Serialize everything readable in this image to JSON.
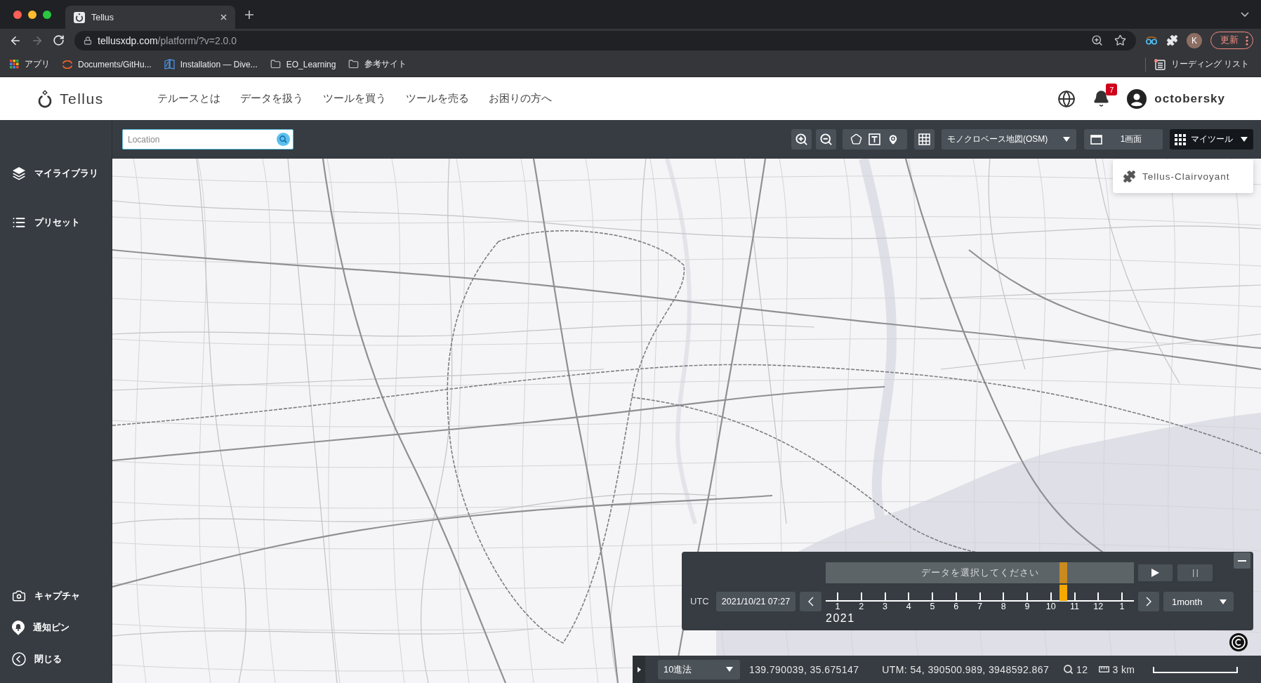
{
  "browser": {
    "tabs": [
      {
        "title": "Tellus",
        "selected": true
      }
    ],
    "url": {
      "host": "tellusxdp.com",
      "path": "/platform/?v=2.0.0"
    },
    "profile_initial": "K",
    "update_button": "更新",
    "bookmarks": [
      {
        "kind": "apps",
        "label": "アプリ"
      },
      {
        "kind": "ring",
        "label": "Documents/GitHu..."
      },
      {
        "kind": "book",
        "label": "Installation — Dive..."
      },
      {
        "kind": "folder",
        "label": "EO_Learning"
      },
      {
        "kind": "folder",
        "label": "参考サイト"
      }
    ],
    "reading_list": "リーディング リスト"
  },
  "header": {
    "logo": "Tellus",
    "nav": [
      "テルースとは",
      "データを扱う",
      "ツールを買う",
      "ツールを売る",
      "お困りの方へ"
    ],
    "notification_count": "7",
    "username": "octobersky"
  },
  "toolbar": {
    "search": {
      "placeholder": "Location"
    },
    "basemap": "モノクロベース地図(OSM)",
    "layout": "1画面",
    "my_tools": {
      "label": "マイツール",
      "expanded": true,
      "items": [
        {
          "label": "Tellus-Clairvoyant"
        }
      ]
    }
  },
  "sidebar": {
    "top": [
      "マイライブラリ",
      "プリセット"
    ],
    "bottom": [
      "キャプチャ",
      "通知ピン",
      "閉じる"
    ]
  },
  "timeline": {
    "prompt": "データを選択してください",
    "timezone": "UTC",
    "datetime": "2021/10/21 07:27",
    "months": [
      "1",
      "2",
      "3",
      "4",
      "5",
      "6",
      "7",
      "8",
      "9",
      "10",
      "11",
      "12",
      "1"
    ],
    "year": "2021",
    "level": 0.77,
    "step": "1month"
  },
  "status_bar": {
    "notation": "10進法",
    "coordinates": "139.790039, 35.675147",
    "utm": "UTM: 54, 390500.989, 3948592.867",
    "zoom": "12",
    "scale": "3 km"
  }
}
